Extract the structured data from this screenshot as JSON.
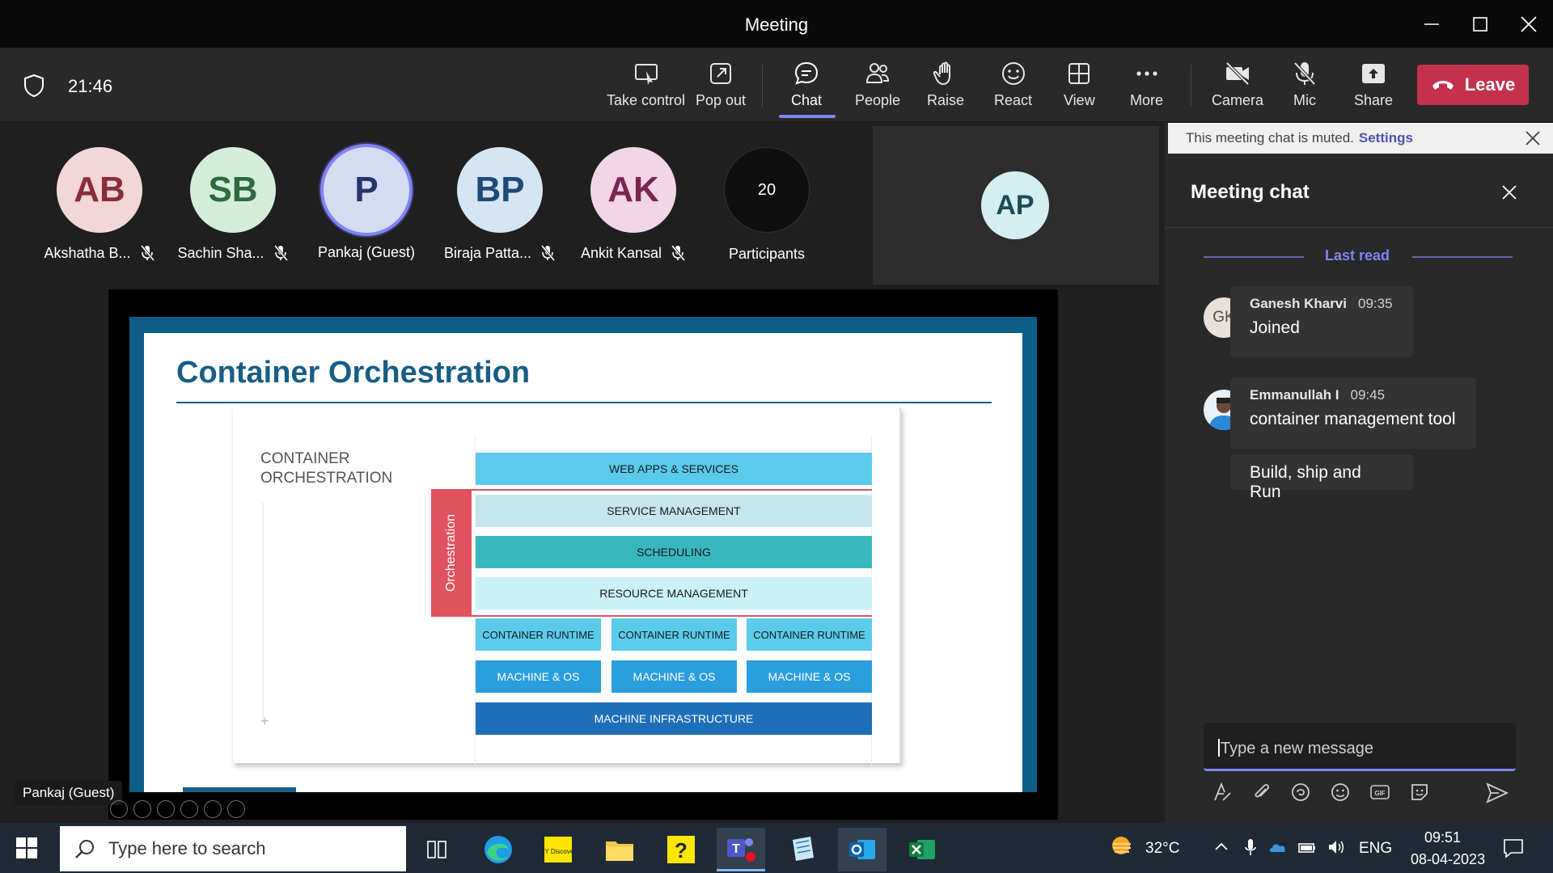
{
  "window": {
    "title": "Meeting"
  },
  "toolbar": {
    "timer": "21:46",
    "buttons": [
      {
        "label": "Take control"
      },
      {
        "label": "Pop out"
      },
      {
        "label": "Chat"
      },
      {
        "label": "People"
      },
      {
        "label": "Raise"
      },
      {
        "label": "React"
      },
      {
        "label": "View"
      },
      {
        "label": "More"
      },
      {
        "label": "Camera"
      },
      {
        "label": "Mic"
      },
      {
        "label": "Share"
      }
    ],
    "leave_label": "Leave"
  },
  "participants": [
    {
      "initials": "AB",
      "name": "Akshatha B...",
      "bg": "#f3d6d8",
      "fg": "#8b2c39"
    },
    {
      "initials": "SB",
      "name": "Sachin Sha...",
      "bg": "#d5eedc",
      "fg": "#2c6b3e"
    },
    {
      "initials": "P",
      "name": "Pankaj (Guest)",
      "bg": "#d4dcf2",
      "fg": "#26346b"
    },
    {
      "initials": "BP",
      "name": "Biraja Patta...",
      "bg": "#d5e5f4",
      "fg": "#1e4a78"
    },
    {
      "initials": "AK",
      "name": "Ankit Kansal",
      "bg": "#f2d5e6",
      "fg": "#7a2552"
    }
  ],
  "participants_count": {
    "count": "20",
    "label": "Participants"
  },
  "tile": {
    "initials": "AP"
  },
  "slide": {
    "title": "Container Orchestration",
    "side_label_line1": "CONTAINER",
    "side_label_line2": "ORCHESTRATION",
    "orchestration_label": "Orchestration",
    "layers": {
      "web_apps": "WEB APPS & SERVICES",
      "service_mgmt": "SERVICE MANAGEMENT",
      "scheduling": "SCHEDULING",
      "resource_mgmt": "RESOURCE MANAGEMENT",
      "container_runtime": "CONTAINER RUNTIME",
      "machine_os": "MACHINE & OS",
      "machine_infra": "MACHINE INFRASTRUCTURE"
    }
  },
  "presenter_tag": "Pankaj (Guest)",
  "chat": {
    "banner_text": "This meeting chat is muted.",
    "banner_link": "Settings",
    "header": "Meeting chat",
    "last_read": "Last read",
    "messages": [
      {
        "initials": "GK",
        "author": "Ganesh Kharvi",
        "time": "09:35",
        "text": "Joined"
      },
      {
        "author": "Emmanullah I",
        "time": "09:45",
        "text": "container management tool"
      },
      {
        "text": "Build, ship and Run"
      }
    ],
    "compose_placeholder": "Type a new message"
  },
  "taskbar": {
    "search_placeholder": "Type here to search",
    "temperature": "32°C",
    "language": "ENG",
    "time": "09:51",
    "date": "08-04-2023",
    "ey_label": "EY Discover"
  },
  "colors": {
    "accent": "#7f85f5",
    "leave": "#c4314b",
    "slide_blue": "#185d86",
    "orchestration_red": "#e0525e"
  }
}
